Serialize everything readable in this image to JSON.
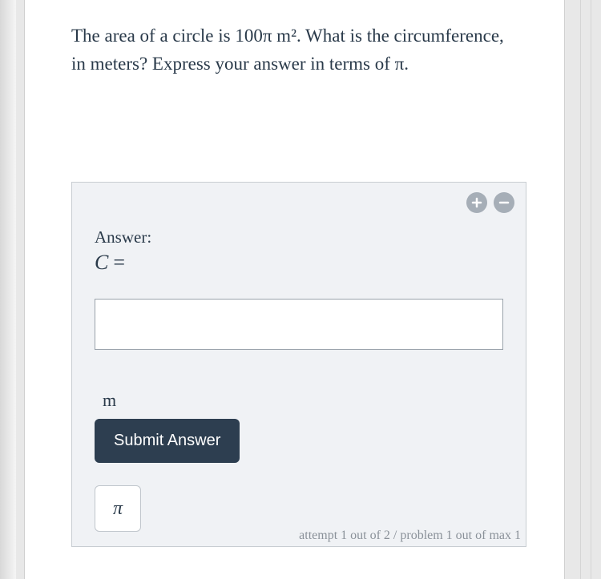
{
  "question": {
    "text": "The area of a circle is 100π m². What is the circumference, in meters? Express your answer in terms of π."
  },
  "answer_panel": {
    "label": "Answer:",
    "variable": "C",
    "eq_sign": "=",
    "input_value": "",
    "units": "m",
    "submit_label": "Submit Answer",
    "pi_label": "π"
  },
  "status": "attempt 1 out of 2 / problem 1 out of max 1"
}
